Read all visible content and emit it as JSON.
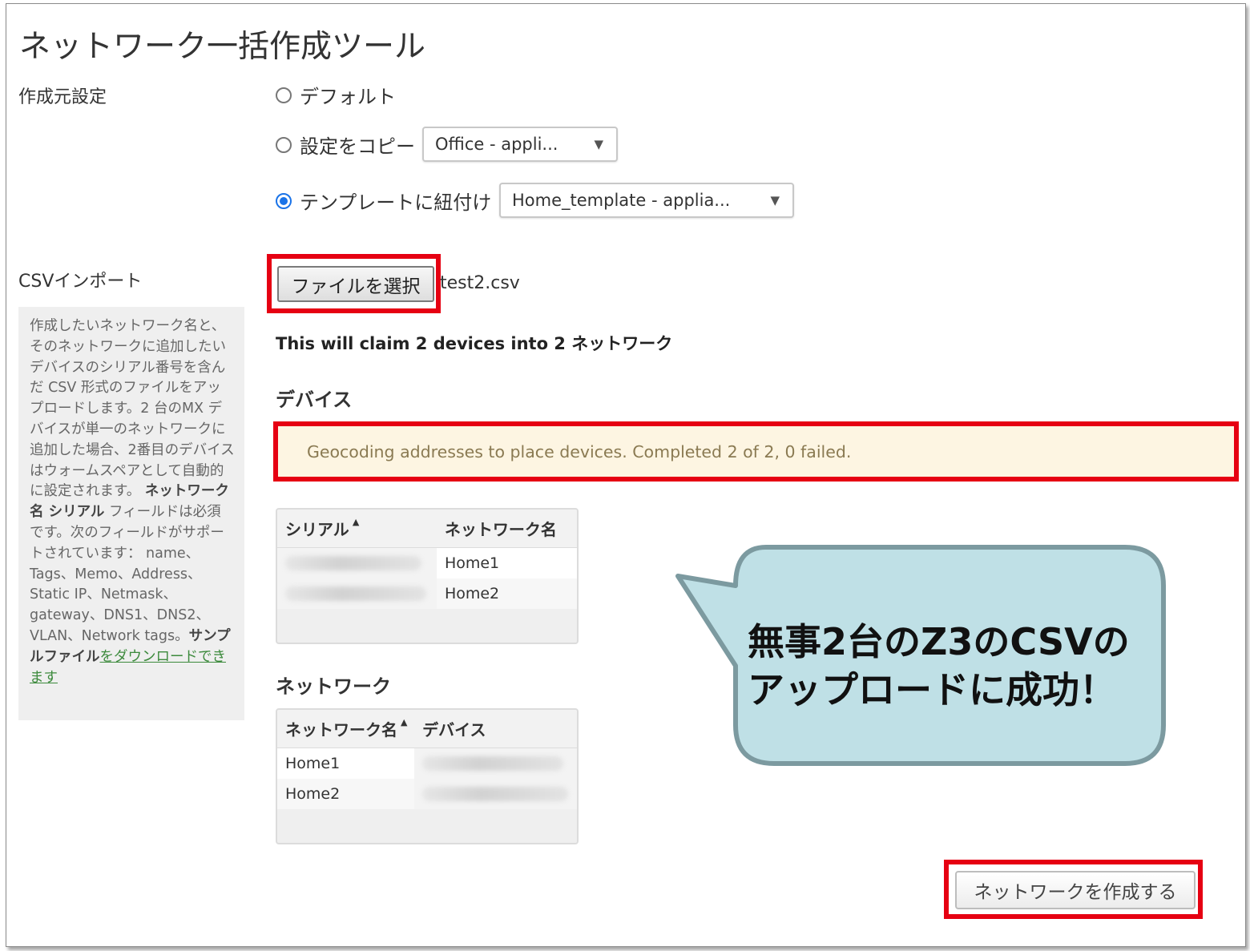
{
  "page": {
    "title": "ネットワーク一括作成ツール"
  },
  "source_settings": {
    "label": "作成元設定",
    "options": [
      {
        "label": "デフォルト",
        "checked": false
      },
      {
        "label": "設定をコピー",
        "checked": false,
        "select_value": "Office - appli..."
      },
      {
        "label": "テンプレートに紐付け",
        "checked": true,
        "select_value": "Home_template - applia..."
      }
    ]
  },
  "csv_import": {
    "label": "CSVインポート",
    "file_button_label": "ファイルを選択",
    "file_name": "test2.csv",
    "help": {
      "text1": "作成したいネットワーク名と、そのネットワークに追加したいデバイスのシリアル番号を含んだ CSV 形式のファイルをアップロードします。2 台のMX デバイスが単一のネットワークに追加した場合、2番目のデバイスはウォームスペアとして自動的に設定されます。",
      "bold1": "ネットワーク名 シリアル",
      "text2": "フィールドは必須です。次のフィールドがサポートされています： name、Tags、Memo、Address、Static IP、Netmask、gateway、DNS1、DNS2、VLAN、Network tags。",
      "bold2": "サンプルファイル",
      "link": "をダウンロードできます"
    }
  },
  "claim_summary": "This will claim 2 devices into 2 ネットワーク",
  "devices_section": {
    "heading": "デバイス",
    "geocoding_status": "Geocoding addresses to place devices. Completed 2 of 2, 0 failed.",
    "table": {
      "headers": [
        "シリアル",
        "ネットワーク名"
      ],
      "sort_indicator": "▲",
      "rows": [
        {
          "network": "Home1"
        },
        {
          "network": "Home2"
        }
      ]
    }
  },
  "networks_section": {
    "heading": "ネットワーク",
    "table": {
      "headers": [
        "ネットワーク名",
        "デバイス"
      ],
      "sort_indicator": "▲",
      "rows": [
        {
          "network": "Home1"
        },
        {
          "network": "Home2"
        }
      ]
    }
  },
  "create_button_label": "ネットワークを作成する",
  "callout": {
    "line1": "無事2台のZ3のCSVの",
    "line2": "アップロードに成功！",
    "fill": "#bfe0e6",
    "stroke": "#7c9aa0"
  },
  "highlight_color": "#e60012"
}
